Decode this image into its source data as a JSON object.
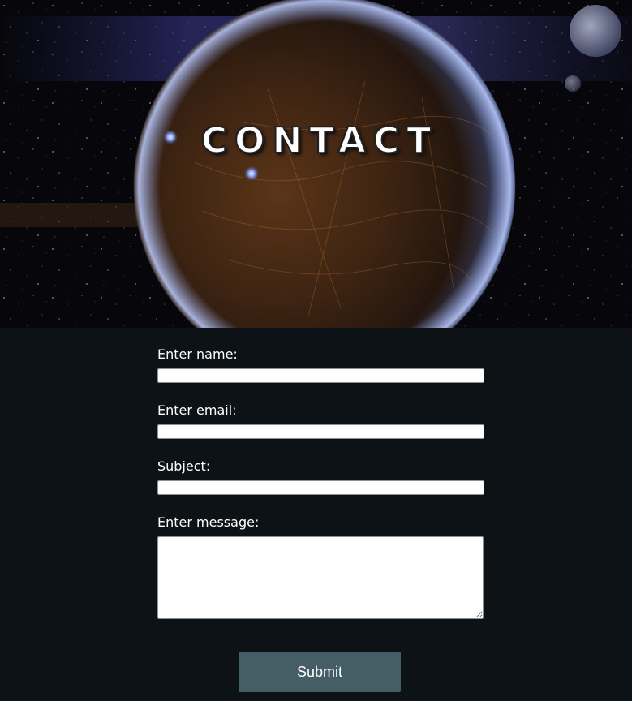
{
  "header": {
    "title": "CONTACT"
  },
  "form": {
    "name_label": "Enter name:",
    "name_value": "",
    "email_label": "Enter email:",
    "email_value": "",
    "subject_label": "Subject:",
    "subject_value": "",
    "message_label": "Enter message:",
    "message_value": "",
    "submit_label": "Submit"
  },
  "colors": {
    "page_background": "#0d1216",
    "button_background": "#455e66",
    "text": "#ffffff",
    "input_background": "#ffffff"
  }
}
